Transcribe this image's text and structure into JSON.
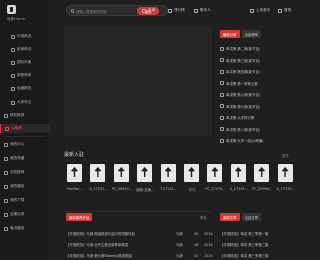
{
  "sidebar": {
    "title": "电影Home",
    "items": [
      {
        "label": "华语精选",
        "sub": true
      },
      {
        "label": "欧美精选",
        "sub": true
      },
      {
        "label": "国际风格",
        "sub": true
      },
      {
        "label": "新歌榜单",
        "sub": true
      },
      {
        "label": "私藏精选",
        "sub": true
      },
      {
        "label": "大家听过",
        "sub": true
      },
      {
        "label": "精彩推荐",
        "sub": false
      },
      {
        "label": "AI推荐",
        "sub": false,
        "active": true
      },
      {
        "label": "我的中心",
        "sub": false
      },
      {
        "label": "我的收藏",
        "sub": false
      },
      {
        "label": "浏览推荐",
        "sub": false
      },
      {
        "label": "我的播放",
        "sub": false
      },
      {
        "label": "我的下载",
        "sub": false
      },
      {
        "label": "近期记录",
        "sub": false
      },
      {
        "label": "最近播放",
        "sub": false
      }
    ]
  },
  "topbar": {
    "search_placeholder": "请输入要搜索的内容~",
    "search_button": "搜索",
    "links": [
      "专辑",
      "排行榜",
      "歌手人",
      "上传音乐",
      "登录"
    ]
  },
  "right_panel": {
    "tabs": [
      "最新分享",
      "全部榜单"
    ],
    "items": [
      "单讲第·第二期(新节目)",
      "单讲第·第三期(新节目)",
      "单讲第·第四期(新节目)",
      "单讲第·第一季第五集",
      "单讲第·第六期(新节目)",
      "单讲第·第七期(新节目)",
      "单讲第·大学排行榜",
      "单讲第·第八期(新节目)",
      "单讲第·大学一组(AI精编)"
    ]
  },
  "latest": {
    "title": "最新入驻",
    "more": "更多",
    "captions": [
      "PanPan...",
      "A_17231...",
      "PC_39953...",
      "朋特·文案...",
      "T-17231...",
      "平凡",
      "PC_27470...",
      "A_17235...",
      "PC_50094...",
      "A_17235..."
    ]
  },
  "bottom_left": {
    "tab": "最新推荐作品",
    "more": "更多",
    "rows": [
      {
        "title": "【华语精选】马静·周迪精选乐曲中的短篇作品",
        "artist": "马静",
        "count": "39",
        "date": "2024"
      },
      {
        "title": "【华语精选】马静·合作主题全新歌单精选",
        "artist": "马静",
        "count": "36",
        "date": "2024"
      },
      {
        "title": "【华语精选】马静·第九期Tabledig精选歌曲",
        "artist": "马静",
        "count": "31",
        "date": "2024"
      }
    ]
  },
  "bottom_right": {
    "tabs": [
      "最新文章",
      "全部文章"
    ],
    "rows": [
      "【华语精选】单讲 第三季第一集",
      "【华语精选】单讲 第三季第二集",
      "【华语精选】单讲 第三季第三集"
    ]
  },
  "colors": {
    "accent": "#d33838",
    "bg": "#1f1f1f",
    "sidebar": "#1a1a1a"
  }
}
